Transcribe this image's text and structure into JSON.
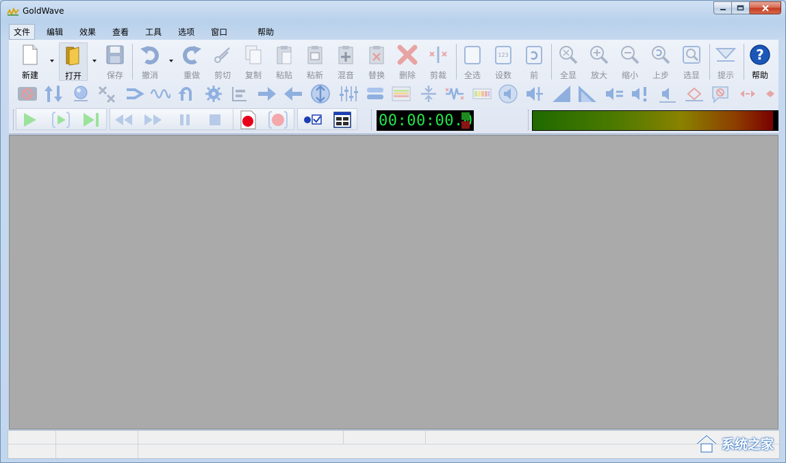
{
  "window": {
    "title": "GoldWave"
  },
  "menu": [
    "文件",
    "编辑",
    "效果",
    "查看",
    "工具",
    "选项",
    "窗口",
    "帮助"
  ],
  "toolbar": {
    "new_label": "新建",
    "open_label": "打开",
    "save_label": "保存",
    "undo_label": "撤消",
    "redo_label": "重做",
    "cut_label": "剪切",
    "copy_label": "复制",
    "paste_label": "粘贴",
    "paste_new_label": "粘新",
    "mix_label": "混音",
    "replace_label": "替换",
    "delete_label": "删除",
    "trim_label": "剪裁",
    "select_all_label": "全选",
    "set_label": "设数",
    "prev_label": "前",
    "show_all_label": "全显",
    "zoom_in_label": "放大",
    "zoom_out_label": "缩小",
    "previous_step_label": "上步",
    "show_selection_label": "选显",
    "hint_label": "提示",
    "help_label": "帮助"
  },
  "transport": {
    "time": "00:00:00.0"
  },
  "watermark": {
    "text": "系统之家"
  },
  "colors": {
    "time_text": "#22e64a",
    "record": "#e8001a",
    "disabled_icon": "#9fb8dc",
    "accent": "#1b57b8"
  }
}
